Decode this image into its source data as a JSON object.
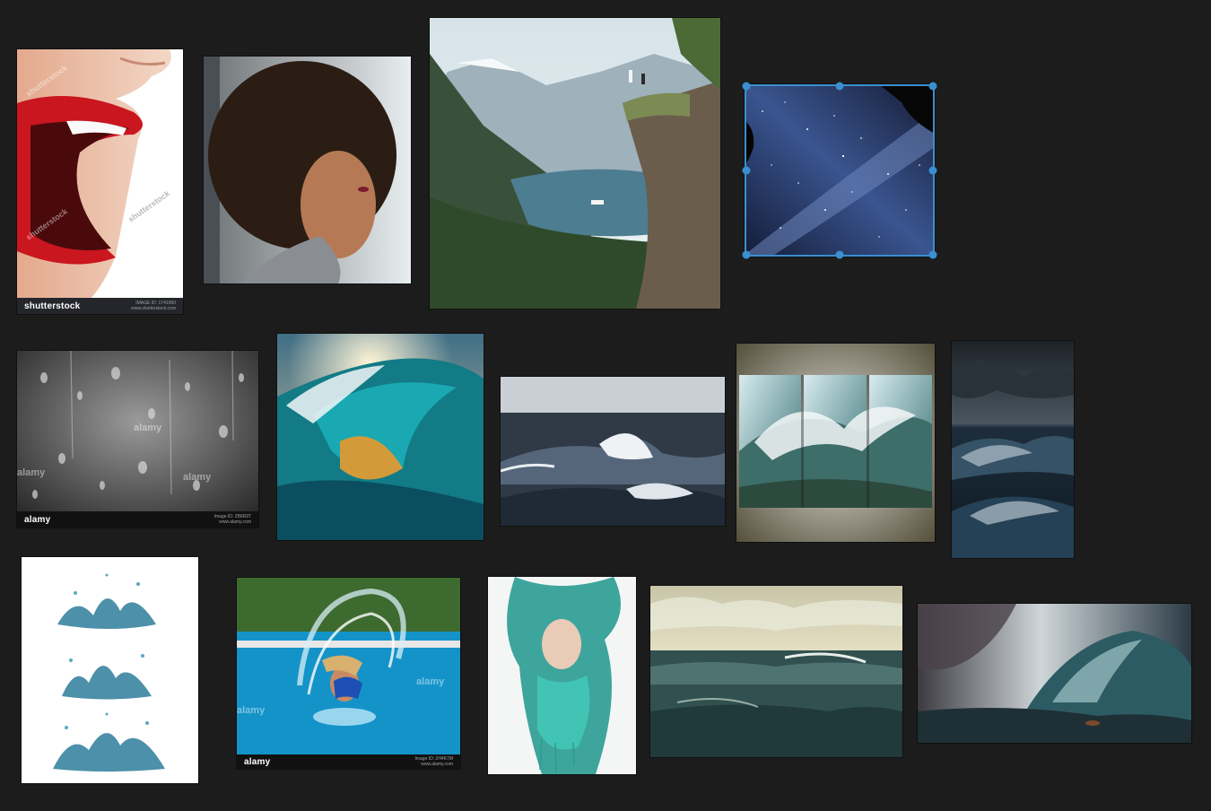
{
  "board": {
    "background": "#1c1c1c",
    "selection_color": "#3a8fd1"
  },
  "tiles": {
    "mouth": {
      "logo": "shutterstock",
      "diag": "shutterstock",
      "meta1": "IMAGE ID: 1741060",
      "meta2": "www.shutterstock.com"
    },
    "woman_profile": {},
    "fjord": {},
    "milky_way": {},
    "rain_glass": {
      "logo": "alamy",
      "diag": "alamy",
      "meta1": "Image ID: 2B6R9T",
      "meta2": "www.alamy.com"
    },
    "golden_wave": {},
    "rough_sea": {},
    "triptych_wave": {},
    "storm_sea": {},
    "water_splashes": {},
    "pool_hair_flip": {
      "logo": "alamy",
      "diag": "alamy",
      "meta1": "Image ID: 2H4K7M",
      "meta2": "www.alamy.com"
    },
    "teal_water_woman": {},
    "ocean_painting": {},
    "storm_wave_painting": {}
  }
}
